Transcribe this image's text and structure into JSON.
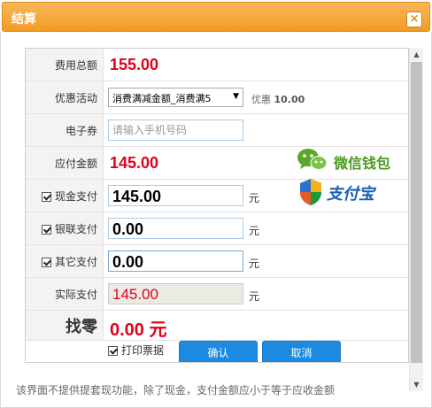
{
  "dialog": {
    "title": "结算",
    "close_glyph": "×"
  },
  "rows": {
    "total": {
      "label": "费用总额",
      "value": "155.00"
    },
    "promo": {
      "label": "优惠活动",
      "selected": "消费满减金额_消费满5",
      "discount_label": "优惠",
      "discount_value": "10.00"
    },
    "coupon": {
      "label": "电子券",
      "placeholder": "请输入手机号码"
    },
    "payable": {
      "label": "应付金额",
      "value": "145.00"
    },
    "cash": {
      "label": "现金支付",
      "value": "145.00",
      "unit": "元",
      "checked": true
    },
    "unionpay": {
      "label": "银联支付",
      "value": "0.00",
      "unit": "元",
      "checked": true
    },
    "other": {
      "label": "其它支付",
      "value": "0.00",
      "unit": "元",
      "checked": true
    },
    "actual": {
      "label": "实际支付",
      "value": "145.00",
      "unit": "元"
    },
    "change": {
      "label": "找零",
      "value": "0.00",
      "unit": "元"
    }
  },
  "payments": {
    "wechat": "微信钱包",
    "alipay": "支付宝"
  },
  "actions": {
    "print_label": "打印票据",
    "print_checked": true,
    "confirm": "确认",
    "cancel": "取消"
  },
  "footer_note": "该界面不提供提套现功能，除了现金，支付金额应小于等于应收金额",
  "colors": {
    "title_bar": "#f29b24",
    "amount_red": "#e0001b",
    "button_blue": "#1b8ae0",
    "wechat_green": "#5aa72a",
    "alipay_blue": "#1a5fb4"
  },
  "icons": [
    "close-icon",
    "wechat-icon",
    "alipay-shield-icon",
    "checkbox-checked-icon",
    "dropdown-arrow-icon",
    "scroll-up-icon",
    "scroll-down-icon"
  ]
}
